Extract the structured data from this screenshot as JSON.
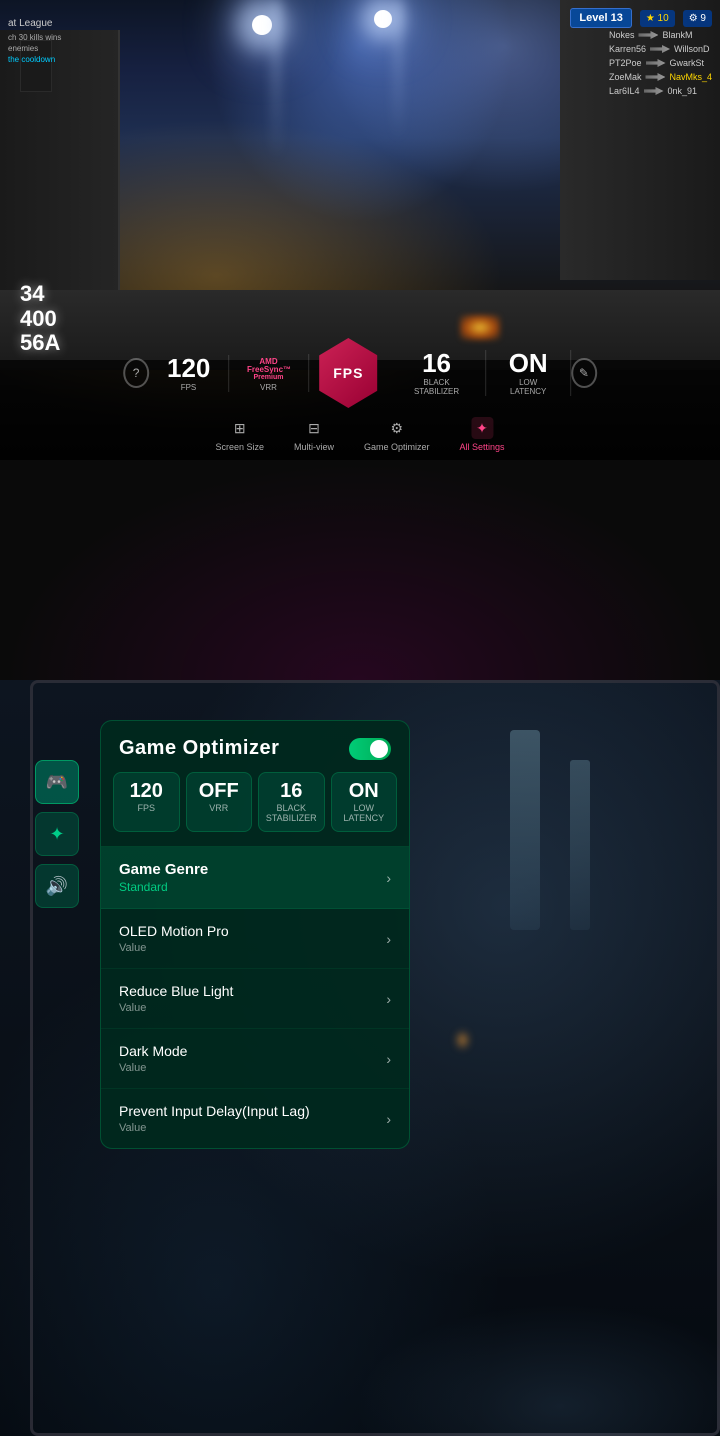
{
  "top": {
    "hud": {
      "level": "Level 13",
      "stars": "★ 10",
      "trophy": "⚙ 9"
    },
    "left_hud": {
      "title": "at League",
      "stat1": "ch 30 kills wins",
      "stat2": "enemies",
      "stat3": "the cooldown"
    },
    "kill_feed": [
      {
        "killer": "Nokes",
        "victim": "BlankM"
      },
      {
        "killer": "Karren56",
        "victim": "WillsonD"
      },
      {
        "killer": "PT2Poe",
        "victim": "GwarkSt"
      },
      {
        "killer": "ZoeMak",
        "victim": "NavMks_4"
      },
      {
        "killer": "Lar6IL4",
        "victim": "0nk_91"
      }
    ],
    "score": {
      "line1": "34",
      "line2": "400",
      "line3": "56A"
    },
    "stats": {
      "fps": "120",
      "fps_label": "FPS",
      "vrr_label": "FPS",
      "vrr_sub1": "AMD",
      "vrr_sub2": "FreeSync",
      "vrr_sub3": "Premium",
      "vrr_value": "VRR",
      "center_badge": "FPS",
      "black_stabilizer": "16",
      "black_stab_label": "Black Stabilizer",
      "low_latency": "ON",
      "low_latency_label": "Low Latency"
    },
    "toolbar": {
      "help": "?",
      "screen_size": "Screen Size",
      "multi_view": "Multi-view",
      "game_optimizer": "Game Optimizer",
      "all_settings": "All Settings",
      "edit": "✎"
    }
  },
  "optimizer": {
    "title": "Game Optimizer",
    "toggle_state": "ON",
    "quick_stats": [
      {
        "value": "120",
        "label": "FPS"
      },
      {
        "value": "OFF",
        "label": "VRR"
      },
      {
        "value": "16",
        "label": "Black Stabilizer"
      },
      {
        "value": "ON",
        "label": "Low Latency"
      }
    ],
    "genre": {
      "label": "Game Genre",
      "value": "Standard"
    },
    "settings": [
      {
        "name": "OLED Motion Pro",
        "value": "Value"
      },
      {
        "name": "Reduce Blue Light",
        "value": "Value"
      },
      {
        "name": "Dark Mode",
        "value": "Value"
      },
      {
        "name": "Prevent Input Delay(Input Lag)",
        "value": "Value"
      }
    ]
  },
  "side_nav": {
    "icons": [
      {
        "name": "gamepad-icon",
        "symbol": "🎮"
      },
      {
        "name": "star-icon",
        "symbol": "✦"
      },
      {
        "name": "volume-icon",
        "symbol": "🔊"
      }
    ]
  }
}
